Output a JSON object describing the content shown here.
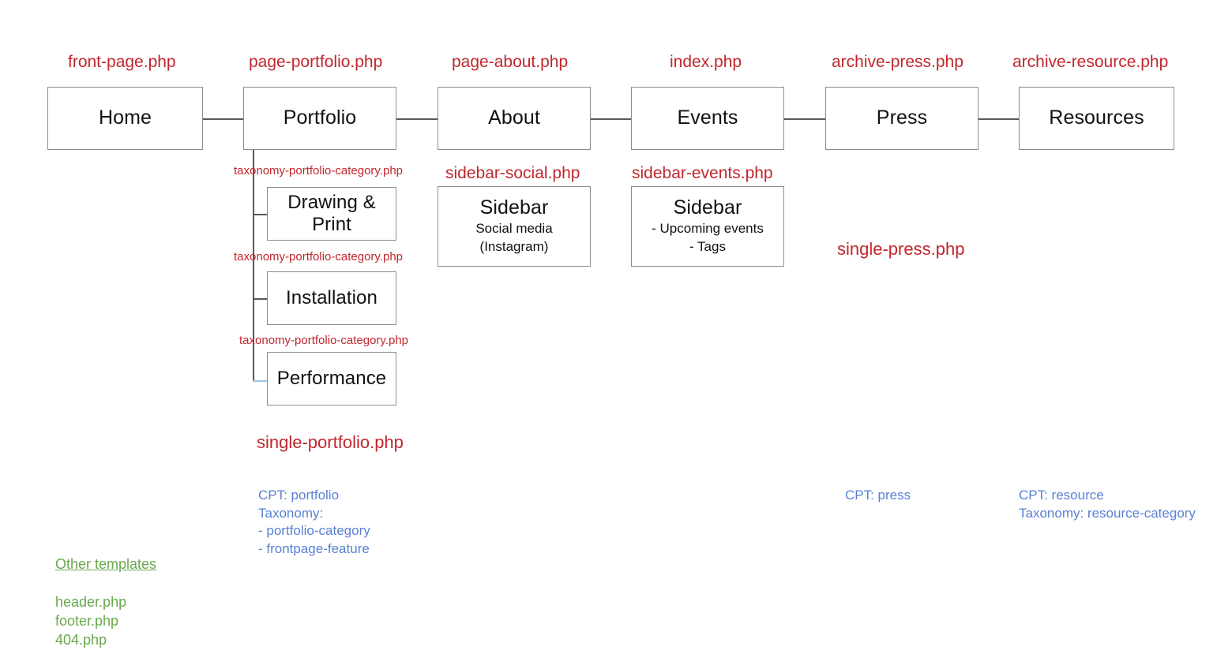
{
  "diagram": {
    "title": "WordPress theme template hierarchy sitemap",
    "colors": {
      "template_label": "#c0272d",
      "note_blue": "#5b81d4",
      "note_green": "#6aa84f",
      "box_border": "#8c8c8c",
      "connector": "#595959",
      "connector_alt": "#9ec3e8",
      "background": "#ffffff"
    }
  },
  "top_row": [
    {
      "label": "Home",
      "template": "front-page.php"
    },
    {
      "label": "Portfolio",
      "template": "page-portfolio.php"
    },
    {
      "label": "About",
      "template": "page-about.php"
    },
    {
      "label": "Events",
      "template": "index.php"
    },
    {
      "label": "Press",
      "template": "archive-press.php"
    },
    {
      "label": "Resources",
      "template": "archive-resource.php"
    }
  ],
  "portfolio_children": [
    {
      "label": "Drawing &\nPrint",
      "template": "taxonomy-portfolio-category.php"
    },
    {
      "label": "Installation",
      "template": "taxonomy-portfolio-category.php"
    },
    {
      "label": "Performance",
      "template": "taxonomy-portfolio-category.php"
    }
  ],
  "sidebars": [
    {
      "template": "sidebar-social.php",
      "title": "Sidebar",
      "body": "Social media\n(Instagram)"
    },
    {
      "template": "sidebar-events.php",
      "title": "Sidebar",
      "body": "- Upcoming events\n- Tags"
    }
  ],
  "single_templates": {
    "portfolio": "single-portfolio.php",
    "press": "single-press.php"
  },
  "notes": {
    "portfolio_cpt": "CPT: portfolio\nTaxonomy:\n- portfolio-category\n- frontpage-feature",
    "press_cpt": "CPT: press",
    "resource_cpt": "CPT: resource\nTaxonomy: resource-category"
  },
  "other_templates": {
    "heading": "Other templates",
    "items": "header.php\nfooter.php\n404.php"
  }
}
